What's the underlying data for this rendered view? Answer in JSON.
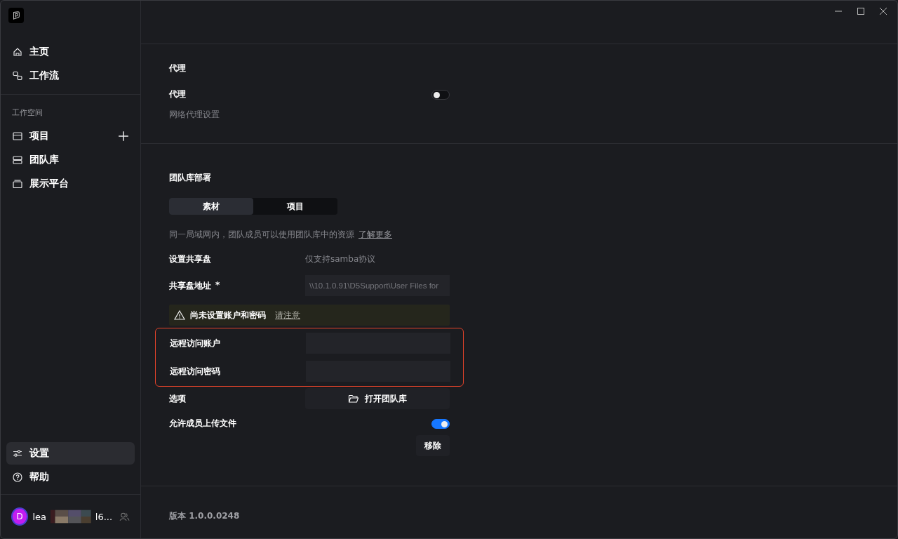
{
  "sidebar": {
    "nav": [
      {
        "label": "主页",
        "selected": false
      },
      {
        "label": "工作流",
        "selected": false
      }
    ],
    "workspace_heading": "工作空间",
    "workspace": [
      {
        "label": "项目",
        "selected": false
      },
      {
        "label": "团队库",
        "selected": false
      },
      {
        "label": "展示平台",
        "selected": false
      }
    ],
    "bottom": [
      {
        "label": "设置",
        "selected": true
      },
      {
        "label": "帮助",
        "selected": false
      }
    ],
    "user": {
      "avatar": "D",
      "name_start": "lea",
      "name_end": "l6..."
    }
  },
  "proxy": {
    "heading": "代理",
    "label": "代理",
    "description": "网络代理设置",
    "on": false
  },
  "team_library": {
    "heading": "团队库部署",
    "tabs": [
      {
        "label": "素材",
        "selected": true
      },
      {
        "label": "项目",
        "selected": false
      }
    ],
    "info": "同一局域网内，团队成员可以使用团队库中的资源",
    "info_link": "了解更多",
    "share_label": "设置共享盘",
    "share_note": "仅支持samba协议",
    "address_label": "共享盘地址",
    "required_mark": "*",
    "address_value": "\\\\10.1.0.91\\D5Support\\User Files for",
    "warning": "尚未设置账户和密码",
    "warning_link": "请注意",
    "account_label": "远程访问账户",
    "password_label": "远程访问密码",
    "options_label": "选项",
    "open_button": "打开团队库",
    "upload_label": "允许成员上传文件",
    "upload_on": true,
    "remove_button": "移除"
  },
  "version": "版本 1.0.0.0248"
}
